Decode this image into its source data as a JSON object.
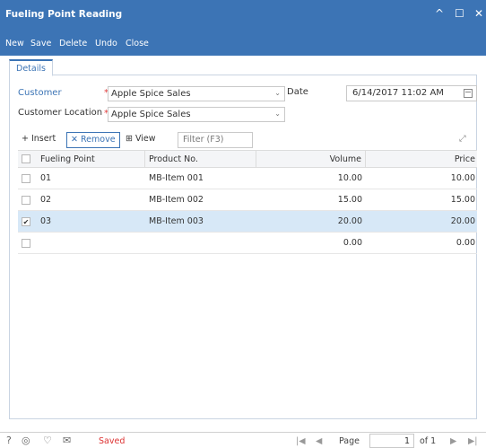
{
  "window": {
    "title": "Fueling Point Reading",
    "controls": [
      "^",
      "☐",
      "✕"
    ]
  },
  "toolbar": {
    "new_label": "New",
    "save_label": "Save",
    "delete_label": "Delete",
    "undo_label": "Undo",
    "close_label": "Close"
  },
  "tabs": [
    {
      "label": "Details"
    }
  ],
  "form": {
    "customer_label": "Customer",
    "customer_value": "Apple Spice Sales",
    "location_label": "Customer Location",
    "location_value": "Apple Spice Sales",
    "date_label": "Date",
    "date_value": "6/14/2017 11:02 AM"
  },
  "grid_toolbar": {
    "insert_label": "Insert",
    "remove_label": "Remove",
    "view_label": "View",
    "filter_placeholder": "Filter (F3)"
  },
  "grid": {
    "columns": [
      "Fueling Point",
      "Product No.",
      "Volume",
      "Price"
    ],
    "rows": [
      {
        "fueling_point": "01",
        "product_no": "MB-Item 001",
        "volume": "10.00",
        "price": "10.00",
        "selected": false
      },
      {
        "fueling_point": "02",
        "product_no": "MB-Item 002",
        "volume": "15.00",
        "price": "15.00",
        "selected": false
      },
      {
        "fueling_point": "03",
        "product_no": "MB-Item 003",
        "volume": "20.00",
        "price": "20.00",
        "selected": true
      },
      {
        "fueling_point": "",
        "product_no": "",
        "volume": "0.00",
        "price": "0.00",
        "selected": false
      }
    ]
  },
  "footer": {
    "status": "Saved",
    "page_label": "Page",
    "page_value": "1",
    "page_total": "of 1"
  }
}
